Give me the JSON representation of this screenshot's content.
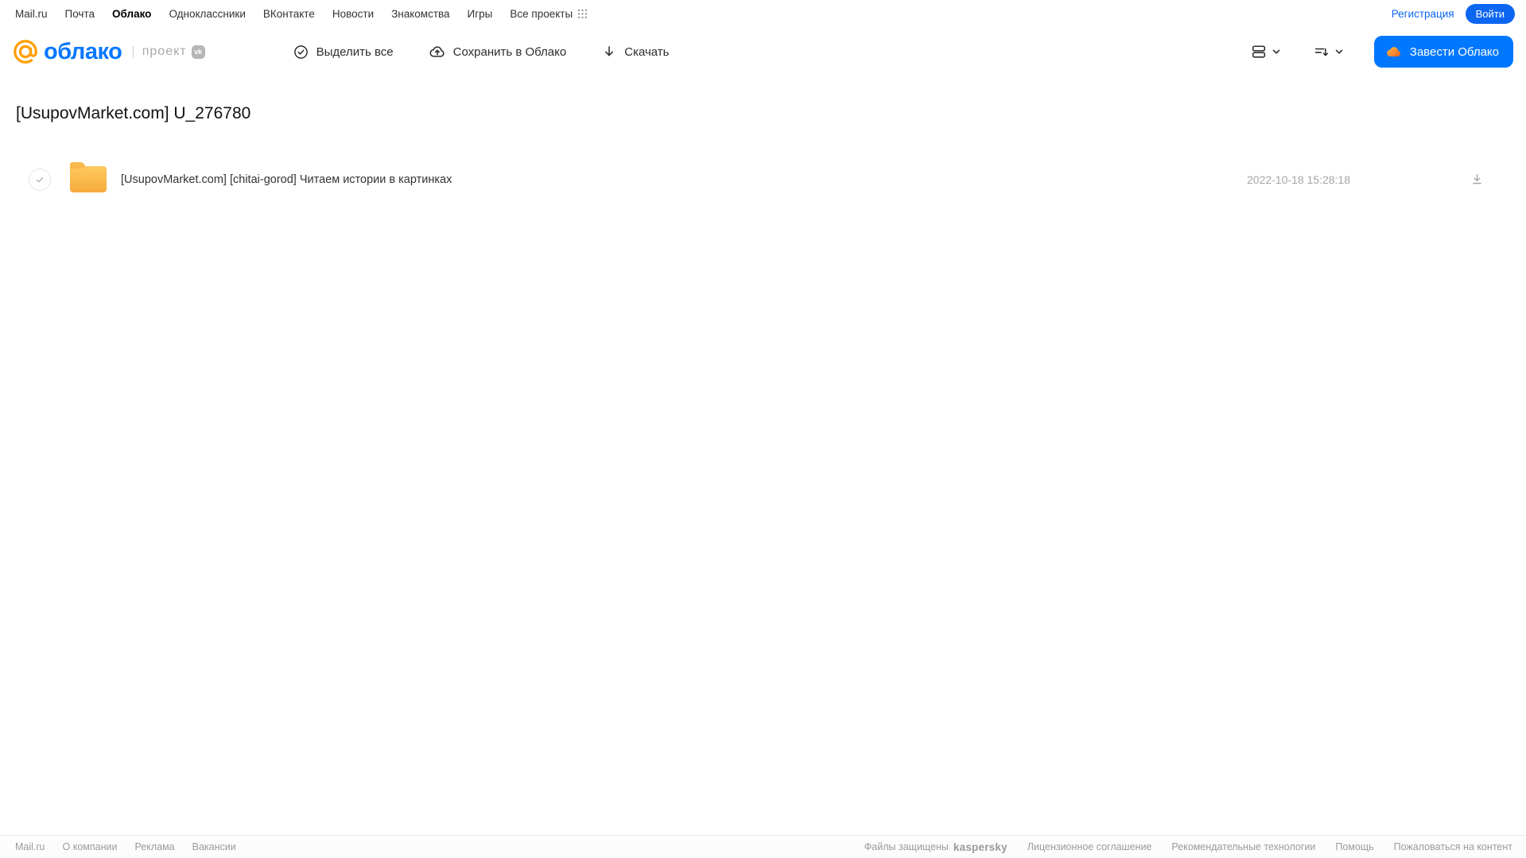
{
  "top_nav": {
    "links": [
      "Mail.ru",
      "Почта",
      "Облако",
      "Одноклассники",
      "ВКонтакте",
      "Новости",
      "Знакомства",
      "Игры",
      "Все проекты"
    ],
    "registration_label": "Регистрация",
    "login_label": "Войти"
  },
  "header": {
    "logo_word": "облако",
    "project_label": "проект",
    "vk_badge": "vk",
    "toolbar": {
      "select_all": "Выделить все",
      "save_to_cloud": "Сохранить в Облако",
      "download": "Скачать"
    },
    "create_cloud_label": "Завести Облако"
  },
  "main": {
    "title": "[UsupovMarket.com] U_276780",
    "files": [
      {
        "name": "[UsupovMarket.com] [chitai-gorod] Читаем истории в картинках",
        "date": "2022-10-18 15:28:18"
      }
    ]
  },
  "footer": {
    "left_links": [
      "Mail.ru",
      "О компании",
      "Реклама",
      "Вакансии"
    ],
    "protected_label": "Файлы защищены",
    "kaspersky_label": "kaspersky",
    "right_links": [
      "Лицензионное соглашение",
      "Рекомендательные технологии",
      "Помощь",
      "Пожаловаться на контент"
    ]
  },
  "icons": {
    "grid_icon": "3x3 dots app grid",
    "check_circle_icon": "circle with checkmark",
    "cloud_upload_icon": "cloud with up arrow",
    "download_icon": "down arrow",
    "list_view_icon": "two stacked rows",
    "sort_icon": "lines with down arrow",
    "chevron_down_icon": "small down chevron",
    "cloud_icon": "orange cloud",
    "at_logo_icon": "orange @ mark"
  },
  "colors": {
    "accent_blue": "#0077ff",
    "login_blue": "#0d66f2",
    "logo_orange": "#ff9e00",
    "folder_yellow": "#f6ab3d",
    "kaspersky_teal": "#00877c",
    "muted_gray": "#a5a5a5"
  }
}
